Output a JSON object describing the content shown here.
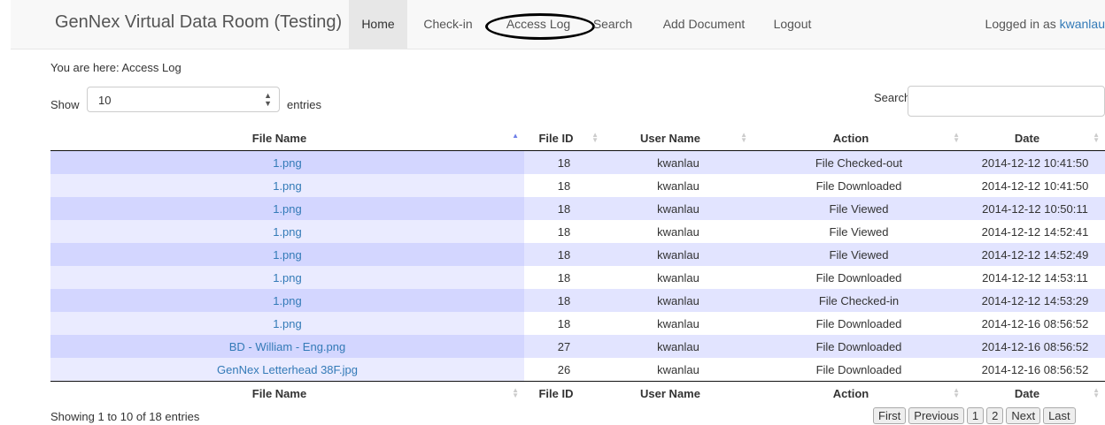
{
  "header": {
    "brand": "GenNex Virtual Data Room (Testing)",
    "nav": [
      "Home",
      "Check-in",
      "Access Log",
      "Search",
      "Add Document",
      "Logout"
    ],
    "active": "Home",
    "logged_in_prefix": "Logged in as",
    "username": "kwanlau"
  },
  "breadcrumb": "You are here: Access Log",
  "length_control": {
    "show_label": "Show",
    "value": "10",
    "entries_label": "entries"
  },
  "search": {
    "label": "Search:",
    "value": ""
  },
  "table": {
    "columns": [
      "File Name",
      "File ID",
      "User Name",
      "Action",
      "Date"
    ],
    "sorted_column": "File Name",
    "sort_direction": "ascending",
    "rows": [
      {
        "file": "1.png",
        "id": "18",
        "user": "kwanlau",
        "action": "File Checked-out",
        "date": "2014-12-12 10:41:50"
      },
      {
        "file": "1.png",
        "id": "18",
        "user": "kwanlau",
        "action": "File Downloaded",
        "date": "2014-12-12 10:41:50"
      },
      {
        "file": "1.png",
        "id": "18",
        "user": "kwanlau",
        "action": "File Viewed",
        "date": "2014-12-12 10:50:11"
      },
      {
        "file": "1.png",
        "id": "18",
        "user": "kwanlau",
        "action": "File Viewed",
        "date": "2014-12-12 14:52:41"
      },
      {
        "file": "1.png",
        "id": "18",
        "user": "kwanlau",
        "action": "File Viewed",
        "date": "2014-12-12 14:52:49"
      },
      {
        "file": "1.png",
        "id": "18",
        "user": "kwanlau",
        "action": "File Downloaded",
        "date": "2014-12-12 14:53:11"
      },
      {
        "file": "1.png",
        "id": "18",
        "user": "kwanlau",
        "action": "File Checked-in",
        "date": "2014-12-12 14:53:29"
      },
      {
        "file": "1.png",
        "id": "18",
        "user": "kwanlau",
        "action": "File Downloaded",
        "date": "2014-12-16 08:56:52"
      },
      {
        "file": "BD - William - Eng.png",
        "id": "27",
        "user": "kwanlau",
        "action": "File Downloaded",
        "date": "2014-12-16 08:56:52"
      },
      {
        "file": "GenNex Letterhead 38F.jpg",
        "id": "26",
        "user": "kwanlau",
        "action": "File Downloaded",
        "date": "2014-12-16 08:56:52"
      }
    ]
  },
  "info": "Showing 1 to 10 of 18 entries",
  "pagination": [
    "First",
    "Previous",
    "1",
    "2",
    "Next",
    "Last"
  ],
  "colors": {
    "link": "#337ab7",
    "row_odd": "#e2e4ff",
    "row_even": "#ffffff",
    "navbar_bg": "#f8f8f8"
  }
}
